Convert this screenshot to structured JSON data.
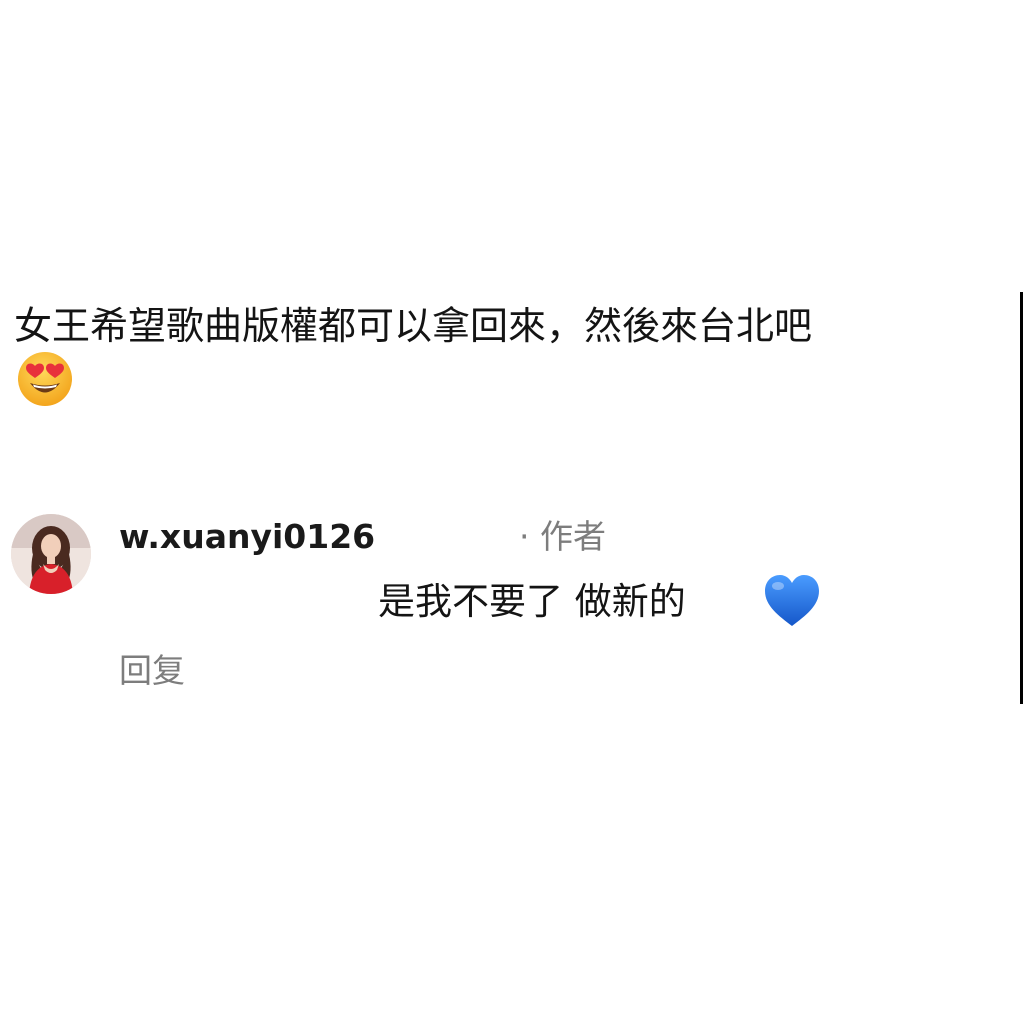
{
  "comment": {
    "text": "女王希望歌曲版權都可以拿回來，然後來台北吧",
    "emoji": "heart-eyes-emoji"
  },
  "reply": {
    "username": "w.xuanyi0126",
    "author_tag": "· 作者",
    "text": "是我不要了 做新的",
    "emoji": "blue-heart-emoji",
    "reply_action_label": "回复"
  },
  "colors": {
    "primary_text": "#141414",
    "secondary_text": "#7d7d7d",
    "emoji_face": "#f8b62a",
    "emoji_heart_red": "#e8313b",
    "emoji_heart_blue": "#1d6fe0"
  }
}
